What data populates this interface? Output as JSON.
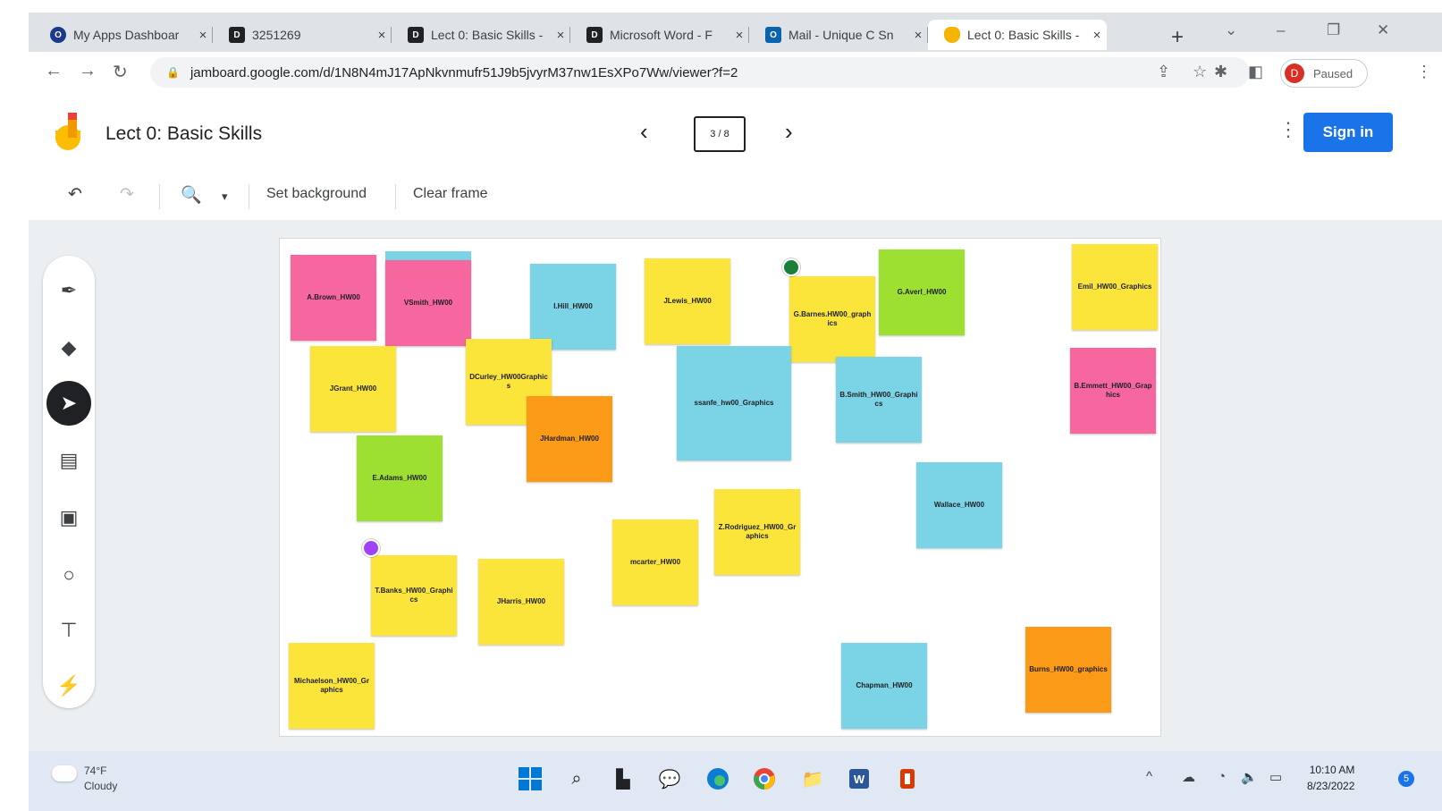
{
  "browser": {
    "tabs": [
      {
        "label": "My Apps Dashboar",
        "favicon": "okta-icon",
        "color": "#1b3a8c"
      },
      {
        "label": "3251269",
        "favicon": "d2l-icon",
        "color": "#202124"
      },
      {
        "label": "Lect 0: Basic Skills -",
        "favicon": "d2l-icon",
        "color": "#202124"
      },
      {
        "label": "Microsoft Word - F",
        "favicon": "d2l-icon",
        "color": "#202124"
      },
      {
        "label": "Mail - Unique C Sn",
        "favicon": "outlook-icon",
        "color": "#0a64ad"
      },
      {
        "label": "Lect 0: Basic Skills -",
        "favicon": "jamboard-icon",
        "color": "#f4b400"
      }
    ],
    "url": "jamboard.google.com/d/1N8N4mJ17ApNkvnmufr51J9b5jvyrM37nw1EsXPo7Ww/viewer?f=2",
    "profile_initial": "D",
    "profile_label": "Paused"
  },
  "app": {
    "title": "Lect 0: Basic Skills",
    "frame_indicator": "3 / 8",
    "sign_in": "Sign in",
    "accent": "#1a73e8"
  },
  "toolbar": {
    "set_background": "Set background",
    "clear_frame": "Clear frame"
  },
  "notes": [
    {
      "text": "A.Brown_HW00",
      "color": "#f6679f"
    },
    {
      "text": "VSmith_HW00",
      "color": "#f6679f"
    },
    {
      "text": "I.Hill_HW00",
      "color": "#7bd3e6"
    },
    {
      "text": "JLewis_HW00",
      "color": "#fbe53b"
    },
    {
      "text": "G.Barnes.HW00_graphics",
      "color": "#fbe53b"
    },
    {
      "text": "G.Averl_HW00",
      "color": "#9ee032"
    },
    {
      "text": "Emil_HW00_Graphics",
      "color": "#fbe53b"
    },
    {
      "text": "JGrant_HW00",
      "color": "#fbe53b"
    },
    {
      "text": "DCurley_HW00Graphics",
      "color": "#fbe53b"
    },
    {
      "text": "ssanfe_hw00_Graphics",
      "color": "#7bd3e6"
    },
    {
      "text": "B.Smith_HW00_Graphics",
      "color": "#7bd3e6"
    },
    {
      "text": "B.Emmett_HW00_Graphics",
      "color": "#f6679f"
    },
    {
      "text": "JHardman_HW00",
      "color": "#fb9a16"
    },
    {
      "text": "E.Adams_HW00",
      "color": "#9ee032"
    },
    {
      "text": "Wallace_HW00",
      "color": "#7bd3e6"
    },
    {
      "text": "Z.Rodriguez_HW00_Graphics",
      "color": "#fbe53b"
    },
    {
      "text": "mcarter_HW00",
      "color": "#fbe53b"
    },
    {
      "text": "JHarris_HW00",
      "color": "#fbe53b"
    },
    {
      "text": "T.Banks_HW00_Graphics",
      "color": "#fbe53b"
    },
    {
      "text": "Michaelson_HW00_Graphics",
      "color": "#fbe53b"
    },
    {
      "text": "Chapman_HW00",
      "color": "#7bd3e6"
    },
    {
      "text": "Burns_HW00_graphics",
      "color": "#fb9a16"
    },
    {
      "text": "",
      "color": "#7bd3e6"
    }
  ],
  "taskbar": {
    "temp": "74°F",
    "condition": "Cloudy",
    "time": "10:10 AM",
    "date": "8/23/2022",
    "notification_count": "5"
  }
}
